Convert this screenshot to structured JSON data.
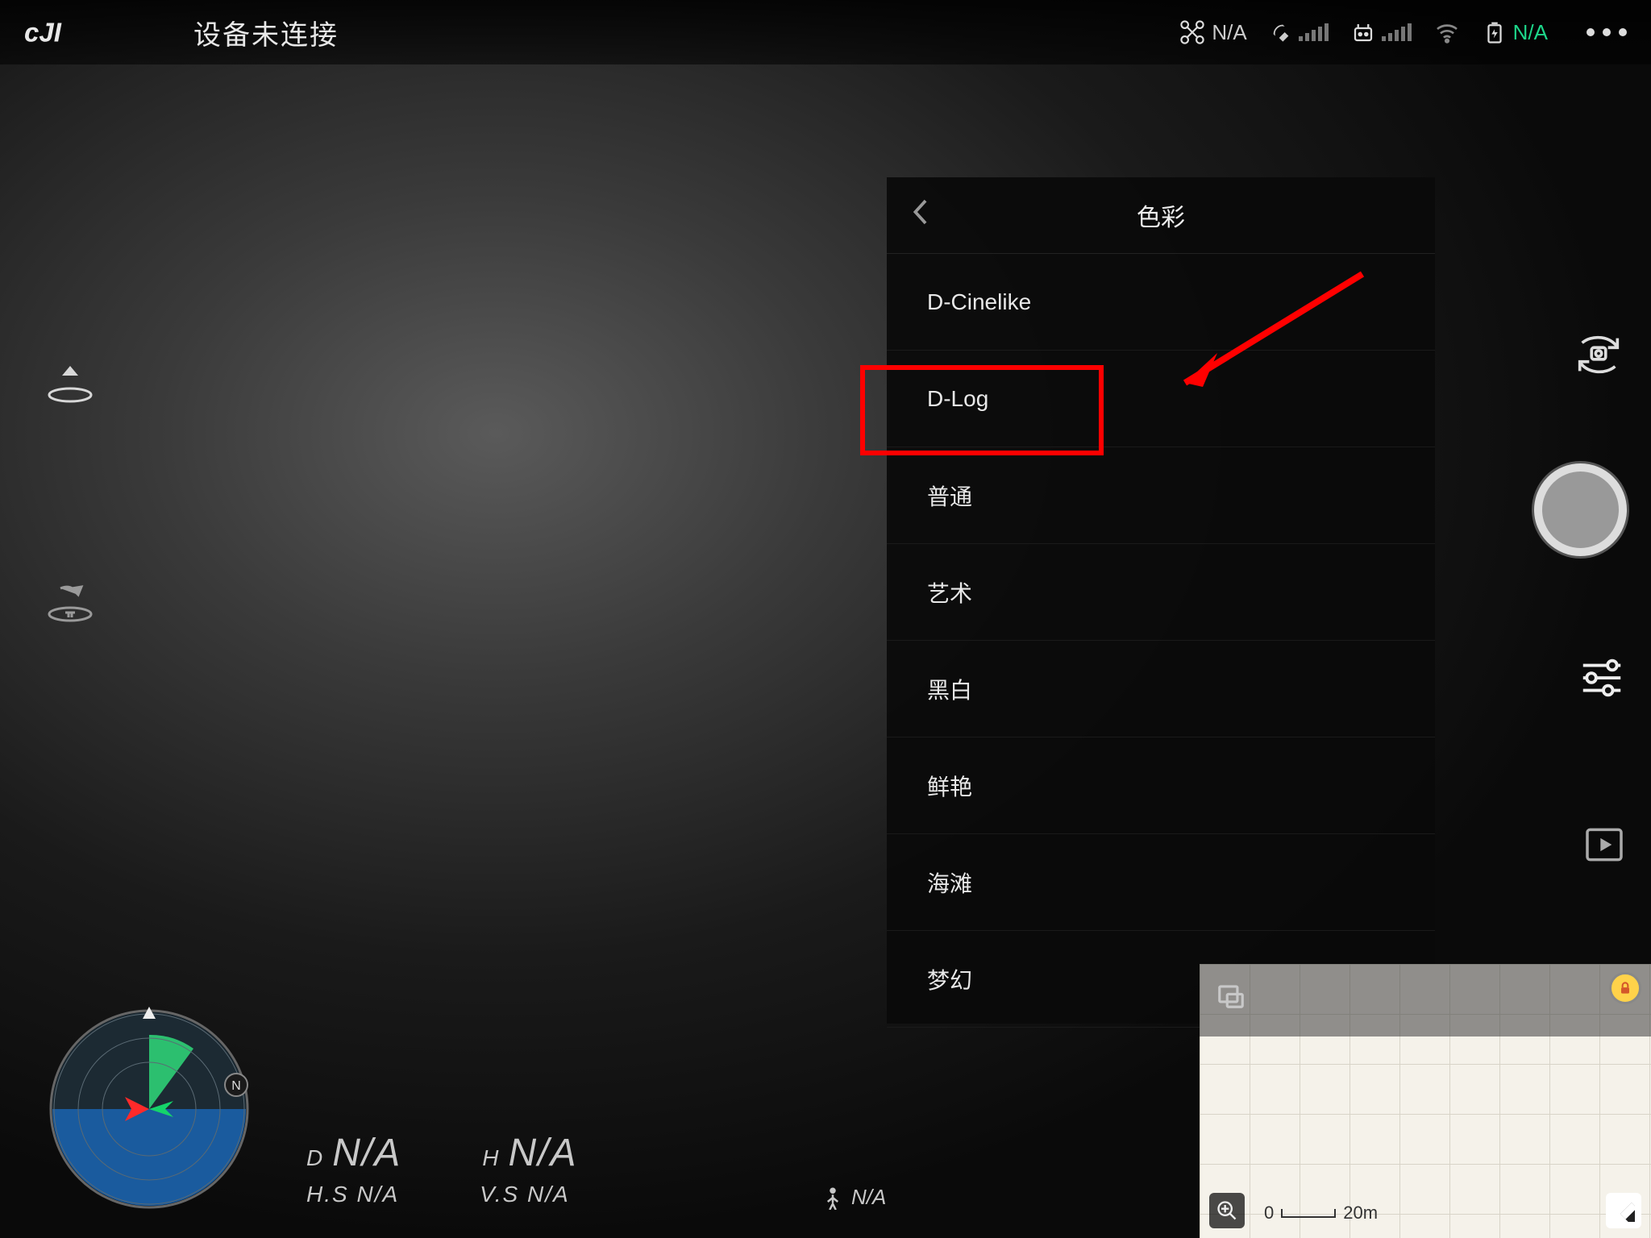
{
  "header": {
    "title": "设备未连接",
    "flight_mode": "N/A",
    "battery": "N/A"
  },
  "color_panel": {
    "title": "色彩",
    "items": [
      "D-Cinelike",
      "D-Log",
      "普通",
      "艺术",
      "黑白",
      "鲜艳",
      "海滩",
      "梦幻"
    ]
  },
  "telemetry": {
    "d_label": "D",
    "d_value": "N/A",
    "h_label": "H",
    "h_value": "N/A",
    "hs_label": "H.S",
    "hs_value": "N/A",
    "vs_label": "V.S",
    "vs_value": "N/A",
    "vps_value": "N/A"
  },
  "map": {
    "scale_low": "0",
    "scale_high": "20m"
  }
}
